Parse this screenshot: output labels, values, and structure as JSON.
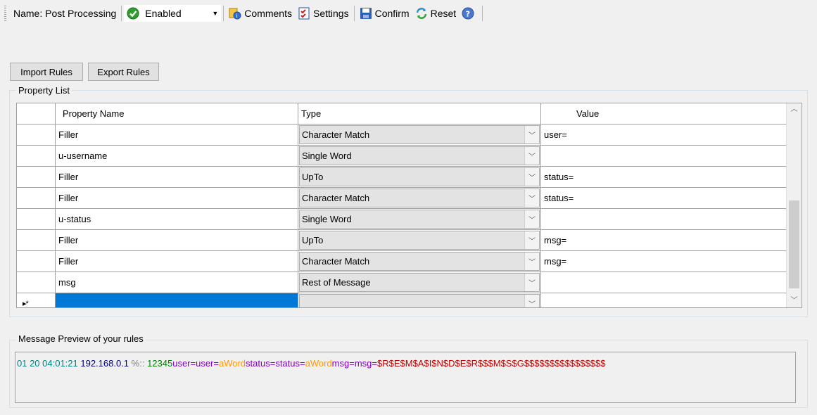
{
  "toolbar": {
    "name_label": "Name: Post Processing",
    "status_value": "Enabled",
    "comments_label": "Comments",
    "settings_label": "Settings",
    "confirm_label": "Confirm",
    "reset_label": "Reset"
  },
  "buttons": {
    "import": "Import Rules",
    "export": "Export Rules"
  },
  "property_list": {
    "title": "Property List",
    "columns": [
      "Property Name",
      "Type",
      "Value"
    ],
    "rows": [
      {
        "name": "Filler",
        "type": "Character Match",
        "value": "user="
      },
      {
        "name": "u-username",
        "type": "Single Word",
        "value": ""
      },
      {
        "name": "Filler",
        "type": "UpTo",
        "value": "status="
      },
      {
        "name": "Filler",
        "type": "Character Match",
        "value": "status="
      },
      {
        "name": "u-status",
        "type": "Single Word",
        "value": ""
      },
      {
        "name": "Filler",
        "type": "UpTo",
        "value": "msg="
      },
      {
        "name": "Filler",
        "type": "Character Match",
        "value": "msg="
      },
      {
        "name": "msg",
        "type": "Rest of Message",
        "value": ""
      }
    ],
    "new_row_marker": "▸*"
  },
  "preview": {
    "title": "Message Preview of your rules",
    "segments": [
      {
        "text": "01 20 04:01:21 ",
        "color": "#008080"
      },
      {
        "text": "192.168.0.1 ",
        "color": "#000080"
      },
      {
        "text": "%:: ",
        "color": "#808080"
      },
      {
        "text": "12345",
        "color": "#008000"
      },
      {
        "text": "user=user=",
        "color": "#8000c0"
      },
      {
        "text": "aWord",
        "color": "#ff9900"
      },
      {
        "text": "status=status=",
        "color": "#8000c0"
      },
      {
        "text": "aWord",
        "color": "#ff9900"
      },
      {
        "text": "msg=msg=",
        "color": "#8000c0"
      },
      {
        "text": "$R$E$M$A$I$N$D$E$R$$$M$S$G$$$$$$$$$$$$$$$$",
        "color": "#c00000"
      }
    ]
  },
  "colors": {
    "selection": "#0078d7",
    "enabled_icon": "#2e9e2e"
  }
}
